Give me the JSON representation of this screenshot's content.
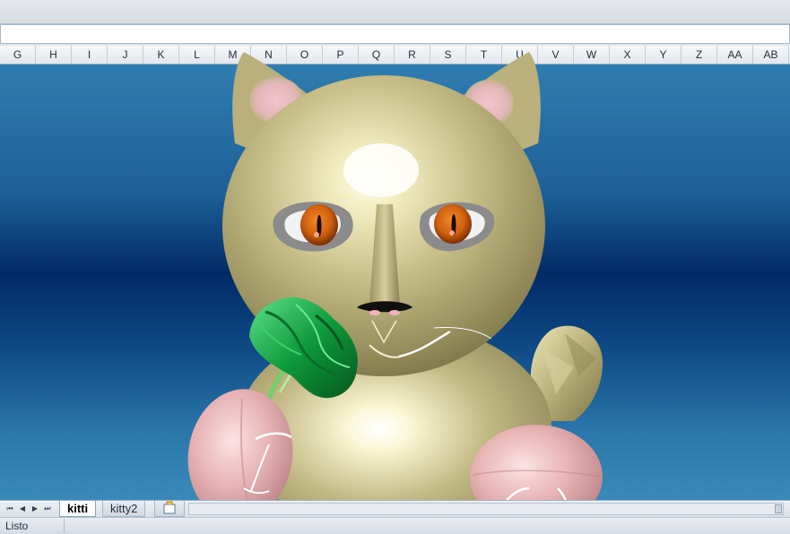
{
  "columns": [
    "G",
    "H",
    "I",
    "J",
    "K",
    "L",
    "M",
    "N",
    "O",
    "P",
    "Q",
    "R",
    "S",
    "T",
    "U",
    "V",
    "W",
    "X",
    "Y",
    "Z",
    "AA",
    "AB"
  ],
  "sheet_tabs": [
    {
      "label": "kitti",
      "active": true
    },
    {
      "label": "kitty2",
      "active": false
    }
  ],
  "status": {
    "text": "Listo"
  },
  "icons": {
    "nav_first": "first-sheet-icon",
    "nav_prev": "prev-sheet-icon",
    "nav_next": "next-sheet-icon",
    "nav_last": "last-sheet-icon",
    "new_sheet": "insert-sheet-icon"
  },
  "colors": {
    "background_top": "#2f7db0",
    "background_mid": "#022a66",
    "cat_body": "#b9b07c",
    "eye_iris": "#d2600e",
    "leaf_green": "#0e9a3c",
    "fish_pink": "#e7b3b5"
  }
}
